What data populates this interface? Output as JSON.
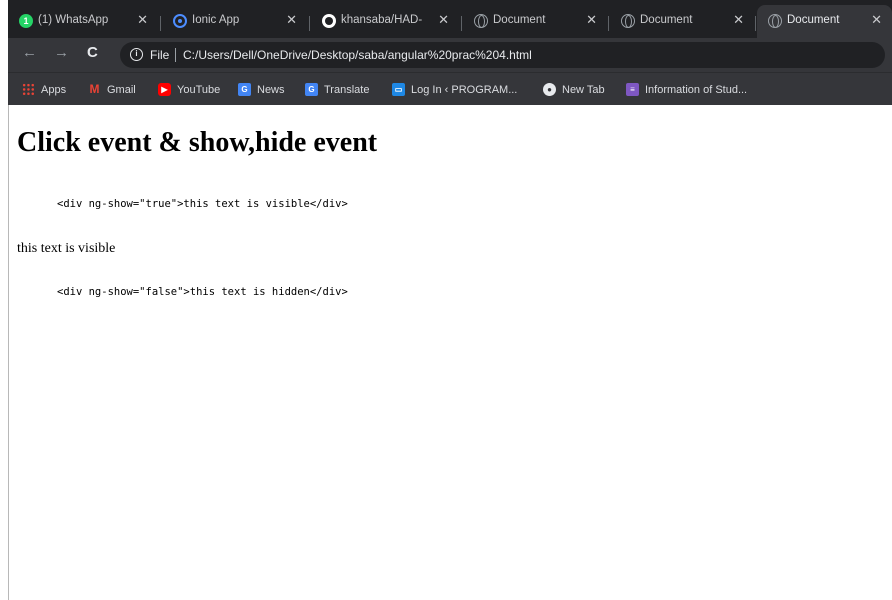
{
  "tabs": [
    {
      "title": "(1) WhatsApp",
      "favicon": "whatsapp-icon",
      "active": false
    },
    {
      "title": "Ionic App",
      "favicon": "ionic-icon",
      "active": false
    },
    {
      "title": "khansaba/HAD-",
      "favicon": "github-icon",
      "active": false
    },
    {
      "title": "Document",
      "favicon": "globe-icon",
      "active": false
    },
    {
      "title": "Document",
      "favicon": "globe-icon",
      "active": false
    },
    {
      "title": "Document",
      "favicon": "globe-icon",
      "active": true
    }
  ],
  "tab_close_glyph": "✕",
  "whatsapp_badge": "1",
  "toolbar": {
    "back_glyph": "←",
    "forward_glyph": "→",
    "reload_glyph": "C",
    "info_glyph": "i",
    "scheme": "File",
    "url": "C:/Users/Dell/OneDrive/Desktop/saba/angular%20prac%204.html"
  },
  "bookmarks": [
    {
      "label": "Apps",
      "icon": "apps-grid-icon"
    },
    {
      "label": "Gmail",
      "icon": "gmail-icon"
    },
    {
      "label": "YouTube",
      "icon": "youtube-icon"
    },
    {
      "label": "News",
      "icon": "news-icon"
    },
    {
      "label": "Translate",
      "icon": "translate-icon"
    },
    {
      "label": "Log In ‹ PROGRAM...",
      "icon": "login-icon"
    },
    {
      "label": "New Tab",
      "icon": "new-tab-icon"
    },
    {
      "label": "Information of Stud...",
      "icon": "form-icon"
    }
  ],
  "bookmark_glyphs": {
    "gmail": "M",
    "youtube": "▶",
    "news": "G",
    "translate": "G",
    "login": "▭",
    "newtab": "●",
    "info": "≡"
  },
  "page": {
    "heading": "Click event & show,hide event",
    "code_visible": "<div ng-show=\"true\">this text is visible</div>",
    "visible_text": "this text is visible",
    "code_hidden": "<div ng-show=\"false\">this text is hidden</div>"
  },
  "colors": {
    "chrome_dark": "#202124",
    "chrome_toolbar": "#35363a",
    "chrome_text": "#e8eaed",
    "page_background": "#ffffff"
  }
}
